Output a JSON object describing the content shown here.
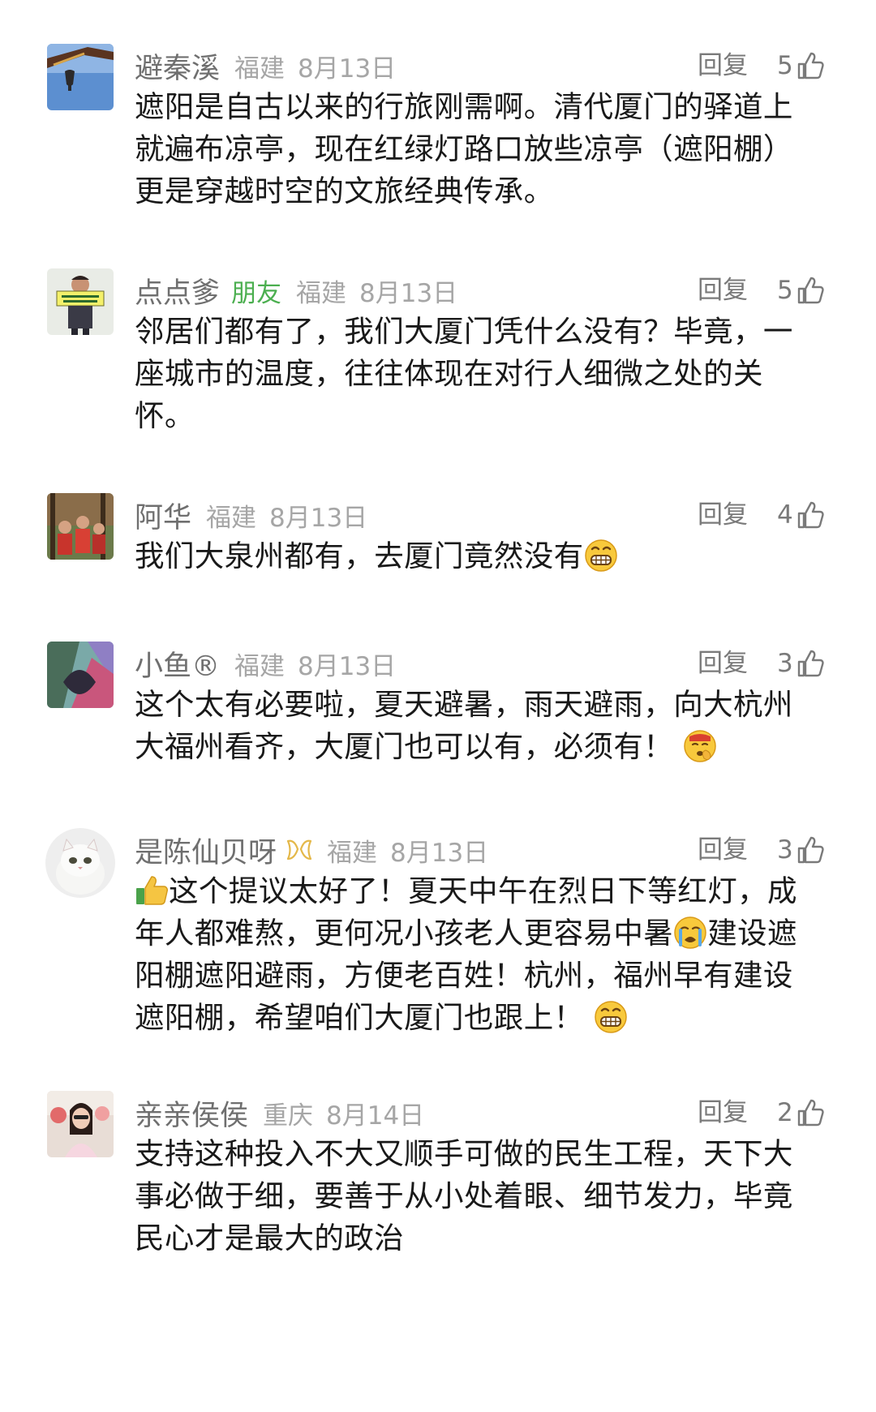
{
  "comments": [
    {
      "name": "避秦溪",
      "friend": "",
      "region": "福建",
      "date": "8月13日",
      "reply": "回复",
      "likes": "5",
      "lines": [
        "遮阳是自古以来的行旅刚需啊。清代厦门的驿道上",
        "就遍布凉亭，现在红绿灯路口放些凉亭（遮阳棚）",
        "更是穿越时空的文旅经典传承。"
      ]
    },
    {
      "name": "点点爹",
      "friend": "朋友",
      "region": "福建",
      "date": "8月13日",
      "reply": "回复",
      "likes": "5",
      "lines": [
        "邻居们都有了，我们大厦门凭什么没有？毕竟，一",
        "座城市的温度，往往体现在对行人细微之处的关",
        "怀。"
      ]
    },
    {
      "name": "阿华",
      "friend": "",
      "region": "福建",
      "date": "8月13日",
      "reply": "回复",
      "likes": "4",
      "lines": [
        "我们大泉州都有，去厦门竟然没有"
      ]
    },
    {
      "name": "小鱼®",
      "friend": "",
      "region": "福建",
      "date": "8月13日",
      "reply": "回复",
      "likes": "3",
      "lines": [
        "这个太有必要啦，夏天避暑，雨天避雨，向大杭州",
        "大福州看齐，大厦门也可以有，必须有！"
      ]
    },
    {
      "name": "是陈仙贝呀",
      "friend": "",
      "region": "福建",
      "date": "8月13日",
      "reply": "回复",
      "likes": "3",
      "lines": [
        "这个提议太好了！夏天中午在烈日下等红灯，成",
        "年人都难熬，更何况小孩老人更容易中暑",
        "建设遮",
        "阳棚遮阳避雨，方便老百姓！杭州，福州早有建设",
        "遮阳棚，希望咱们大厦门也跟上！"
      ]
    },
    {
      "name": "亲亲侯侯",
      "friend": "",
      "region": "重庆",
      "date": "8月14日",
      "reply": "回复",
      "likes": "2",
      "lines": [
        "支持这种投入不大又顺手可做的民生工程，天下大",
        "事必做于细，要善于从小处着眼、细节发力，毕竟",
        "民心才是最大的政治"
      ]
    }
  ],
  "icons": {
    "like": "thumbs-up-icon",
    "grin": "grinning-face-emoji",
    "thumb_emoji": "thumbs-up-emoji",
    "cry": "crying-face-emoji",
    "shush": "shushing-face-emoji",
    "vip": "vip-ribbon-icon"
  }
}
